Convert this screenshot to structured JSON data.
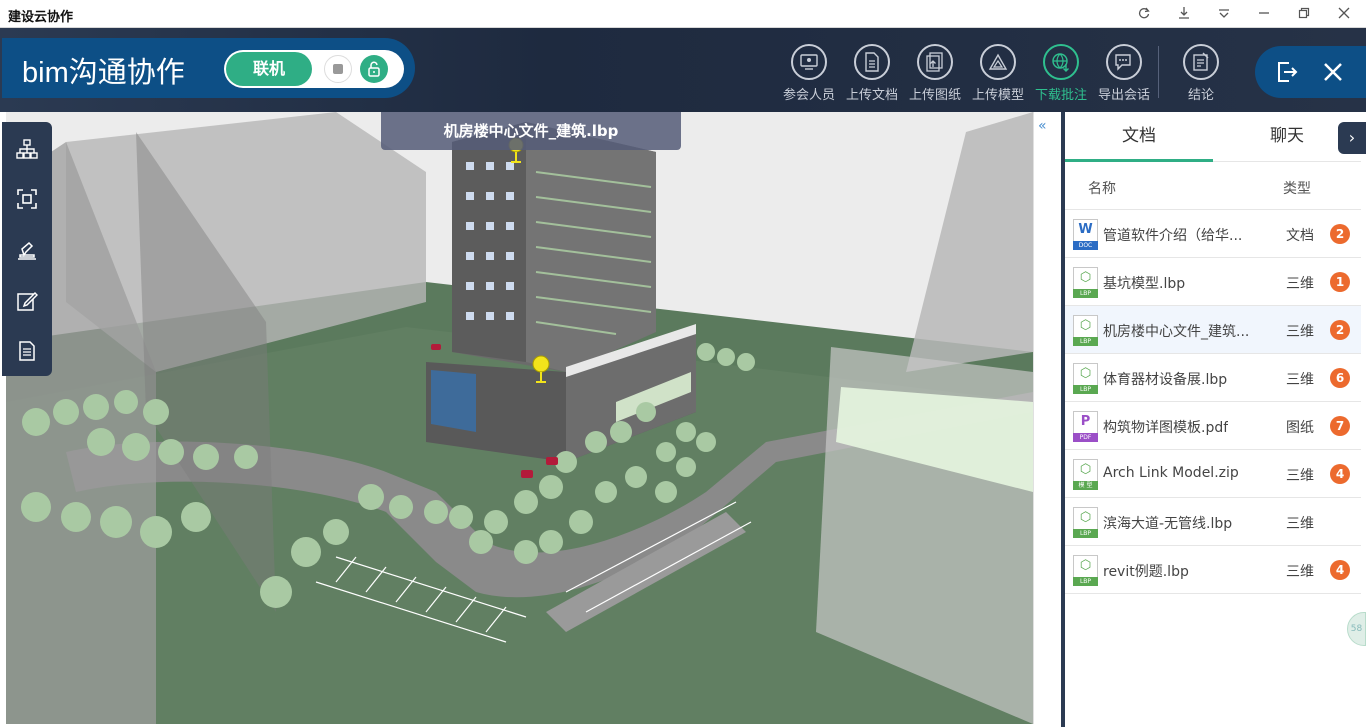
{
  "window": {
    "title": "建设云协作",
    "controls": [
      "refresh-icon",
      "download-icon",
      "dropdown-icon",
      "minimize-icon",
      "maximize-icon",
      "close-icon"
    ]
  },
  "brand": {
    "name": "bim沟通协作",
    "toggle_label": "联机"
  },
  "toolbar": {
    "items": [
      {
        "label": "参会人员",
        "icon": "participants-icon"
      },
      {
        "label": "上传文档",
        "icon": "upload-document-icon"
      },
      {
        "label": "上传图纸",
        "icon": "upload-drawing-icon"
      },
      {
        "label": "上传模型",
        "icon": "upload-model-icon"
      },
      {
        "label": "下载批注",
        "icon": "download-annotation-icon",
        "active": true
      },
      {
        "label": "导出会话",
        "icon": "export-chat-icon"
      },
      {
        "label": "结论",
        "icon": "conclusion-icon"
      }
    ],
    "accent": "#2fc08f"
  },
  "viewport": {
    "title": "机房楼中心文件_建筑.lbp",
    "left_tools": [
      "tree-icon",
      "fit-view-icon",
      "stamp-icon",
      "edit-icon",
      "notes-icon"
    ]
  },
  "panel": {
    "tabs": [
      "文档",
      "聊天"
    ],
    "active_tab": 0,
    "columns": {
      "name": "名称",
      "type": "类型"
    },
    "files": [
      {
        "name": "管道软件介绍（给华...",
        "type": "文档",
        "badge": "2",
        "icon": "doc",
        "tag": "DOC",
        "glyph": "W",
        "color": "#2b6cc4"
      },
      {
        "name": "基坑模型.lbp",
        "type": "三维",
        "badge": "1",
        "icon": "lbp",
        "tag": "LBP",
        "glyph": "⬡",
        "color": "#5aa851"
      },
      {
        "name": "机房楼中心文件_建筑...",
        "type": "三维",
        "badge": "2",
        "icon": "lbp",
        "tag": "LBP",
        "glyph": "⬡",
        "color": "#5aa851",
        "selected": true
      },
      {
        "name": "体育器材设备展.lbp",
        "type": "三维",
        "badge": "6",
        "icon": "lbp",
        "tag": "LBP",
        "glyph": "⬡",
        "color": "#5aa851"
      },
      {
        "name": "构筑物详图模板.pdf",
        "type": "图纸",
        "badge": "7",
        "icon": "pdf",
        "tag": "PDF",
        "glyph": "P",
        "color": "#9b4fc7"
      },
      {
        "name": "Arch Link Model.zip",
        "type": "三维",
        "badge": "4",
        "icon": "model",
        "tag": "模 型",
        "glyph": "⬡",
        "color": "#5aa851"
      },
      {
        "name": "滨海大道-无管线.lbp",
        "type": "三维",
        "badge": "",
        "icon": "lbp",
        "tag": "LBP",
        "glyph": "⬡",
        "color": "#5aa851"
      },
      {
        "name": "revit例题.lbp",
        "type": "三维",
        "badge": "4",
        "icon": "lbp",
        "tag": "LBP",
        "glyph": "⬡",
        "color": "#5aa851"
      }
    ],
    "badge_color": "#ec6a2e"
  },
  "float_button": "58"
}
